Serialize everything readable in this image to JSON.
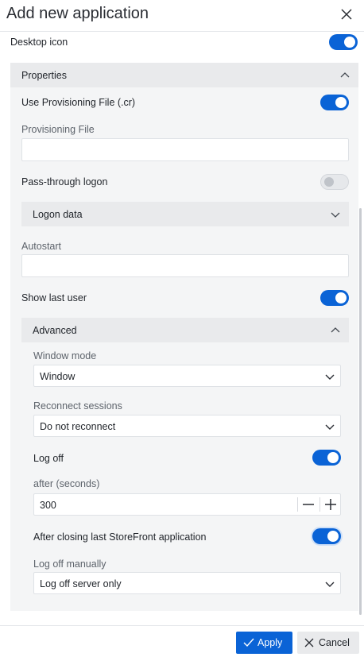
{
  "dialog": {
    "title": "Add new application"
  },
  "desktop_icon": {
    "label": "Desktop icon",
    "enabled": true
  },
  "properties": {
    "header": "Properties",
    "use_provisioning": {
      "label": "Use Provisioning File (.cr)",
      "enabled": true
    },
    "provisioning_file": {
      "label": "Provisioning File",
      "value": ""
    },
    "pass_through": {
      "label": "Pass-through logon",
      "enabled": false
    },
    "logon_data": {
      "header": "Logon data"
    },
    "autostart": {
      "label": "Autostart",
      "value": ""
    },
    "show_last_user": {
      "label": "Show last user",
      "enabled": true
    },
    "advanced": {
      "header": "Advanced",
      "window_mode": {
        "label": "Window mode",
        "value": "Window"
      },
      "reconnect": {
        "label": "Reconnect sessions",
        "value": "Do not reconnect"
      },
      "log_off": {
        "label": "Log off",
        "enabled": true
      },
      "after_seconds": {
        "label": "after (seconds)",
        "value": "300"
      },
      "after_closing": {
        "label": "After closing last StoreFront application",
        "enabled": true
      },
      "log_off_manually": {
        "label": "Log off manually",
        "value": "Log off server only"
      }
    }
  },
  "footer": {
    "apply_label": "Apply",
    "cancel_label": "Cancel"
  },
  "colors": {
    "accent": "#0a63d6",
    "panel": "#f4f5f6",
    "section_header": "#e9eaec"
  }
}
